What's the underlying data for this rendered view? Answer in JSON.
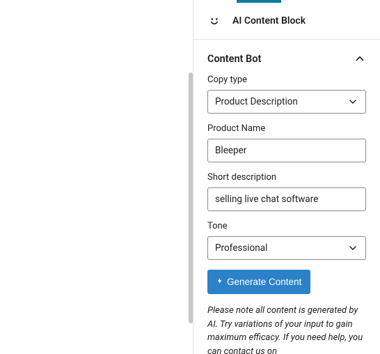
{
  "header": {
    "title": "AI Content Block",
    "icon": "smile-icon"
  },
  "section": {
    "title": "Content Bot",
    "expanded": true
  },
  "fields": {
    "copy_type": {
      "label": "Copy type",
      "value": "Product Description",
      "options": [
        "Product Description"
      ]
    },
    "product_name": {
      "label": "Product Name",
      "value": "Bleeper"
    },
    "short_description": {
      "label": "Short description",
      "value": "selling live chat software"
    },
    "tone": {
      "label": "Tone",
      "value": "Professional",
      "options": [
        "Professional"
      ]
    }
  },
  "actions": {
    "generate_label": "Generate Content"
  },
  "note": "Please note all content is generated by AI. Try variations of your input to gain maximum efficacy. If you need help, you can contact us on"
}
